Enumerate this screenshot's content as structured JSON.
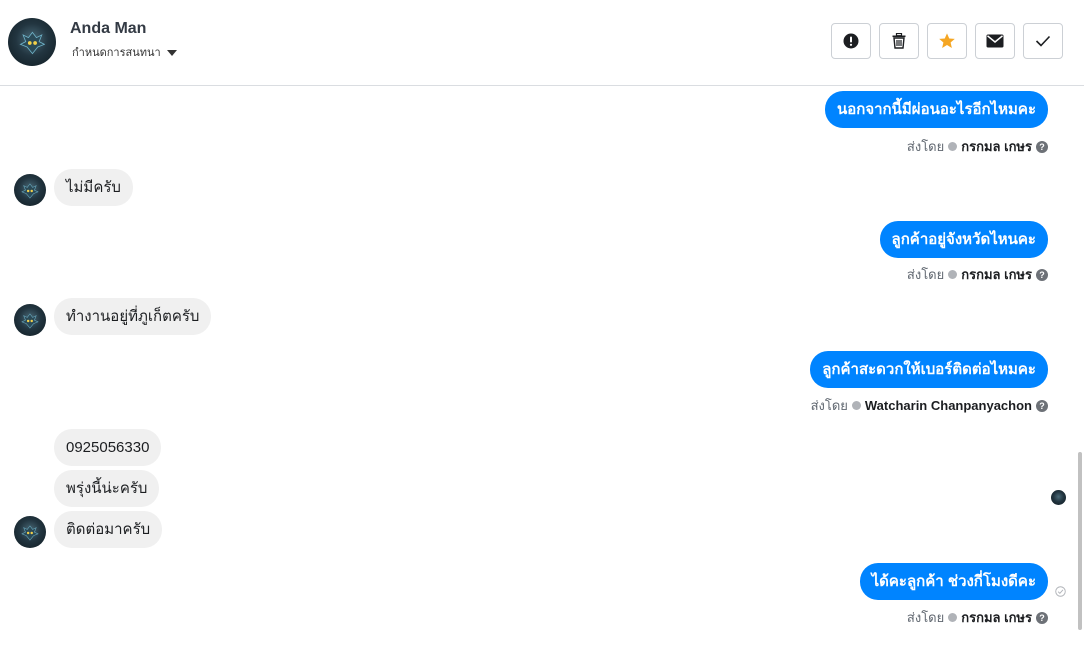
{
  "header": {
    "contact_name": "Anda Man",
    "contact_sub": "กำหนดการสนทนา",
    "buttons": [
      {
        "name": "alert-icon"
      },
      {
        "name": "trash-icon"
      },
      {
        "name": "star-icon",
        "color": "#f5a623"
      },
      {
        "name": "envelope-icon"
      },
      {
        "name": "check-icon"
      }
    ]
  },
  "sent_by_prefix": "ส่งโดย",
  "help_glyph": "?",
  "messages": [
    {
      "dir": "out",
      "text": "นอกจากนี้มีผ่อนอะไรอีกไหมคะ",
      "sender": "กรกมล เกษร"
    },
    {
      "dir": "in",
      "text": "ไม่มีครับ"
    },
    {
      "dir": "out",
      "text": "ลูกค้าอยู่จังหวัดไหนคะ",
      "sender": "กรกมล เกษร"
    },
    {
      "dir": "in",
      "text": "ทำงานอยู่ที่ภูเก็ตครับ"
    },
    {
      "dir": "out",
      "text": "ลูกค้าสะดวกให้เบอร์ติดต่อไหมคะ",
      "sender": "Watcharin Chanpanyachon"
    },
    {
      "dir": "in",
      "text": "0925056330"
    },
    {
      "dir": "in",
      "text": "พรุ่งนี้น่ะครับ"
    },
    {
      "dir": "in",
      "text": "ติดต่อมาครับ"
    },
    {
      "dir": "out",
      "text": "ได้คะลูกค้า ช่วงกี่โมงดีคะ",
      "sender": "กรกมล เกษร"
    }
  ],
  "colors": {
    "outgoing": "#0084ff",
    "incoming": "#f0f0f0",
    "star": "#f5a623"
  }
}
